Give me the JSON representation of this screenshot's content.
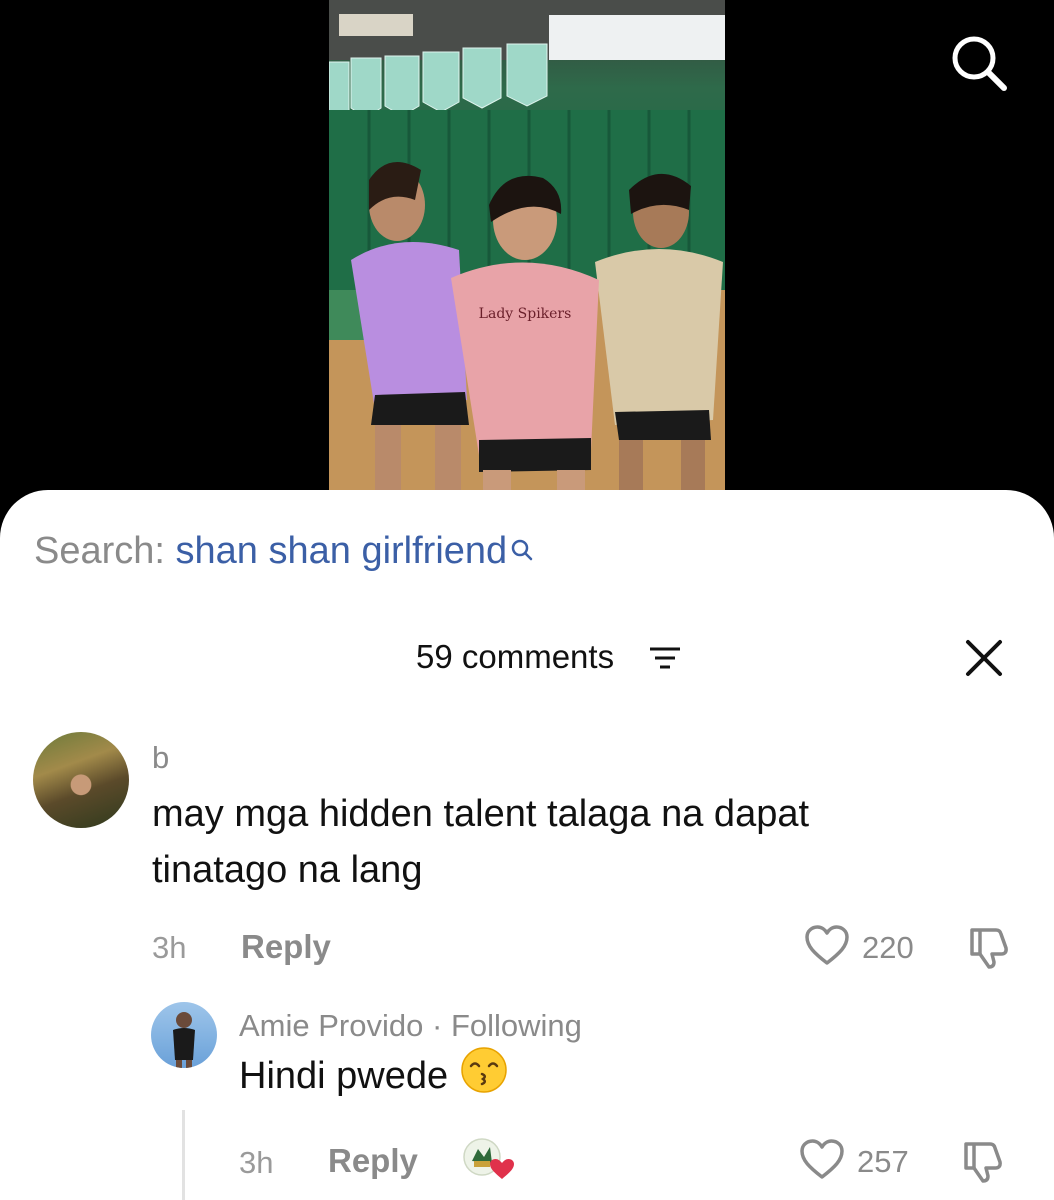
{
  "search": {
    "prefix": "Search:",
    "query": "shan shan girlfriend"
  },
  "comments_header": {
    "count_label": "59 comments"
  },
  "comments": [
    {
      "username": "b",
      "text": "may mga hidden talent talaga na dapat tinatago na lang",
      "time": "3h",
      "reply_label": "Reply",
      "likes": "220"
    }
  ],
  "replies": [
    {
      "username": "Amie Provido",
      "separator": "·",
      "relation": "Following",
      "text": "Hindi pwede",
      "emoji": "kissing-smiling-eyes-emoji",
      "time": "3h",
      "reply_label": "Reply",
      "likes": "257"
    }
  ],
  "video": {
    "shirt_text": "Lady Spikers"
  },
  "colors": {
    "query_blue": "#3b5fa6",
    "muted": "#8a8a8a",
    "heart_red": "#e0314b"
  }
}
